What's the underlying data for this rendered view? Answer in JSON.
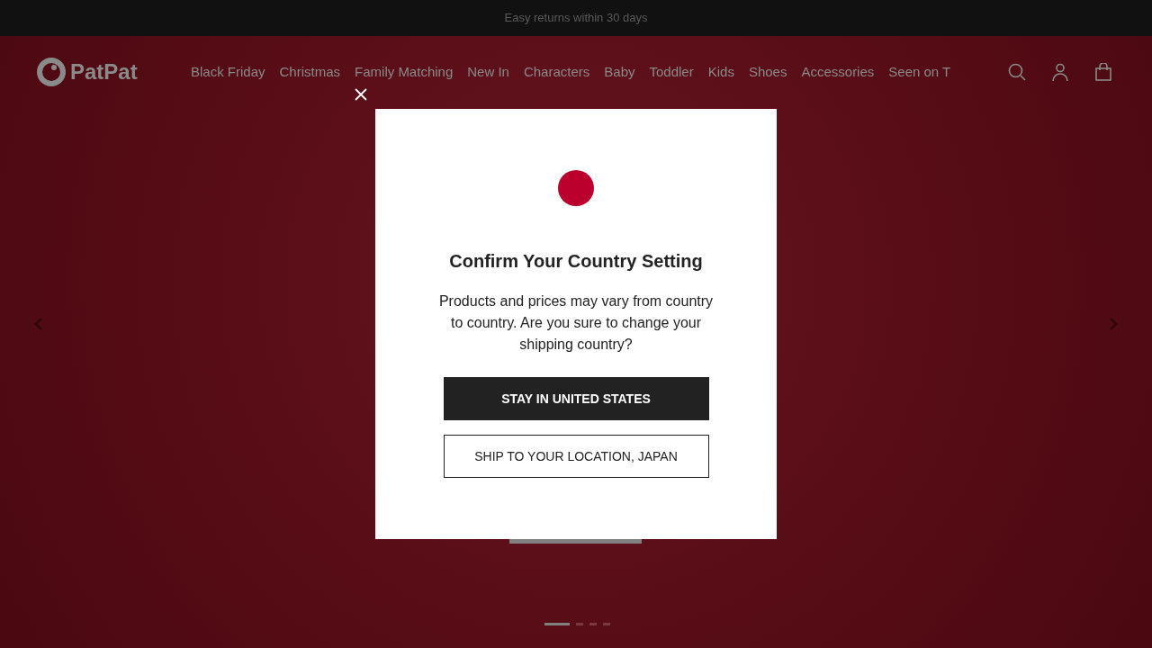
{
  "announcement": "Easy returns within 30 days",
  "header": {
    "logo": "PatPat",
    "nav": [
      "Black Friday",
      "Christmas",
      "Family Matching",
      "New In",
      "Characters",
      "Baby",
      "Toddler",
      "Kids",
      "Shoes",
      "Accessories",
      "Seen on T"
    ]
  },
  "carousel": {
    "slides": [
      {
        "selected": true
      },
      {
        "selected": false
      },
      {
        "selected": false
      },
      {
        "selected": false
      }
    ]
  },
  "dialog": {
    "title": "Confirm Your Country Setting",
    "message": "Products and prices may vary from country to country. Are you sure to change your shipping country?",
    "buttons": [
      {
        "label": "STAY IN UNITED STATES",
        "kind": "primary"
      },
      {
        "label": "SHIP TO YOUR LOCATION, JAPAN",
        "kind": "secondary"
      }
    ]
  }
}
